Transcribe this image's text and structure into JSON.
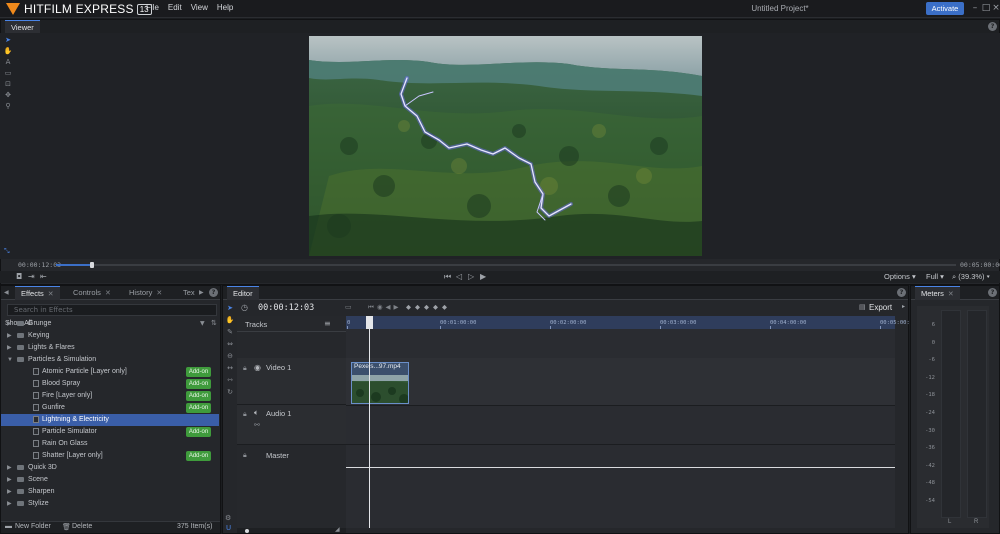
{
  "app": {
    "logo_text": "HITFILM EXPRESS",
    "version": "13",
    "menu": [
      "File",
      "Edit",
      "View",
      "Help"
    ],
    "project_title": "Untitled Project*",
    "activate_label": "Activate"
  },
  "viewer": {
    "tab_label": "Viewer",
    "current_time": "00:00:12:03",
    "end_time": "00:05:00:00",
    "options_label": "Options",
    "quality_label": "Full",
    "zoom_label": "(39.3%)",
    "playhead_fraction": 0.04
  },
  "effects": {
    "tabs": [
      "Effects",
      "Controls",
      "History",
      "Tex"
    ],
    "search_placeholder": "Search in Effects",
    "filter_label": "Show All",
    "tree": [
      {
        "label": "Grunge",
        "type": "folder"
      },
      {
        "label": "Keying",
        "type": "folder"
      },
      {
        "label": "Lights & Flares",
        "type": "folder"
      },
      {
        "label": "Particles & Simulation",
        "type": "folder",
        "open": true
      },
      {
        "label": "Atomic Particle [Layer only]",
        "type": "item",
        "addon": "Add-on"
      },
      {
        "label": "Blood Spray",
        "type": "item",
        "addon": "Add-on"
      },
      {
        "label": "Fire [Layer only]",
        "type": "item",
        "addon": "Add-on"
      },
      {
        "label": "Gunfire",
        "type": "item",
        "addon": "Add-on"
      },
      {
        "label": "Lightning & Electricity",
        "type": "item",
        "selected": true
      },
      {
        "label": "Particle Simulator",
        "type": "item",
        "addon": "Add-on"
      },
      {
        "label": "Rain On Glass",
        "type": "item"
      },
      {
        "label": "Shatter [Layer only]",
        "type": "item",
        "addon": "Add-on"
      },
      {
        "label": "Quick 3D",
        "type": "folder"
      },
      {
        "label": "Scene",
        "type": "folder"
      },
      {
        "label": "Sharpen",
        "type": "folder"
      },
      {
        "label": "Stylize",
        "type": "folder"
      }
    ],
    "footer": {
      "new_folder": "New Folder",
      "delete": "Delete",
      "count": "375 Item(s)"
    }
  },
  "editor": {
    "tab_label": "Editor",
    "timecode": "00:00:12:03",
    "export_label": "Export",
    "tracks_label": "Tracks",
    "ruler_labels": [
      "0",
      "00:01:00:00",
      "00:02:00:00",
      "00:03:00:00",
      "00:04:00:00",
      "00:05:00:00"
    ],
    "video_track": "Video 1",
    "audio_track": "Audio 1",
    "master_track": "Master",
    "clip_name": "Pexels...97.mp4"
  },
  "meters": {
    "tab_label": "Meters",
    "scale": [
      "6",
      "0",
      "-6",
      "-12",
      "-18",
      "-24",
      "-30",
      "-36",
      "-42",
      "-48",
      "-54"
    ],
    "channels": [
      "L",
      "R"
    ]
  }
}
